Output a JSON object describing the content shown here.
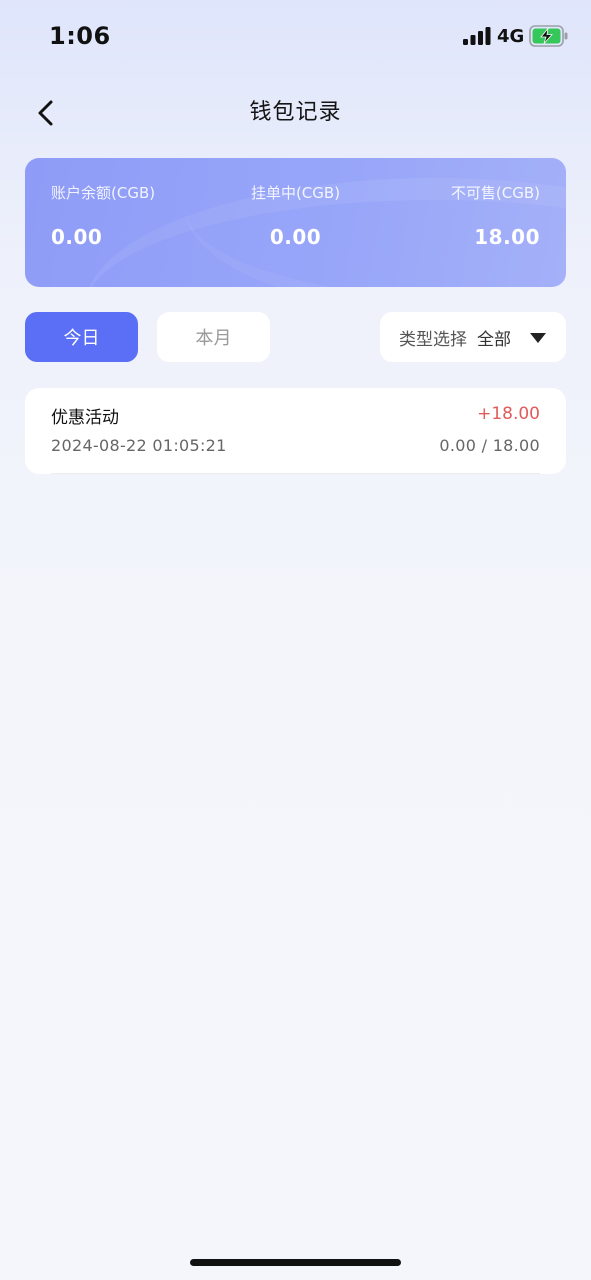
{
  "status_bar": {
    "time": "1:06",
    "network": "4G",
    "icons": [
      "signal-icon",
      "battery-charging-icon"
    ]
  },
  "header": {
    "title": "钱包记录",
    "back_icon": "chevron-left-icon"
  },
  "balance_card": {
    "account_balance_label": "账户余额(CGB)",
    "account_balance_value": "0.00",
    "pending_label": "挂单中(CGB)",
    "pending_value": "0.00",
    "unsellable_label": "不可售(CGB)",
    "unsellable_value": "18.00"
  },
  "filters": {
    "tabs": [
      {
        "label": "今日",
        "selected": true
      },
      {
        "label": "本月",
        "selected": false
      }
    ],
    "type_select_label": "类型选择",
    "type_select_value": "全部",
    "type_select_icon": "caret-down-icon"
  },
  "records": [
    {
      "title": "优惠活动",
      "amount": "+18.00",
      "time": "2024-08-22 01:05:21",
      "balance": "0.00 / 18.00"
    }
  ],
  "colors": {
    "accent": "#5b6ef6",
    "card_background": "#95a3f8",
    "amount_positive": "#e25a5a"
  }
}
